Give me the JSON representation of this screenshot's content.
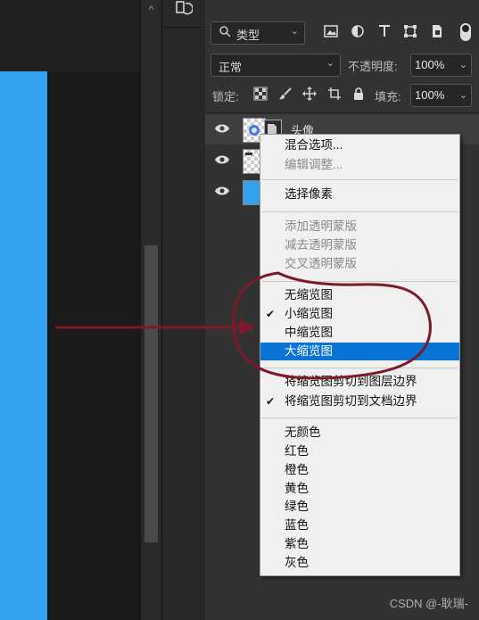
{
  "filter": {
    "label": "类型"
  },
  "blend": {
    "mode": "正常",
    "opacity_label": "不透明度:",
    "opacity_value": "100%"
  },
  "lock": {
    "label": "锁定:",
    "fill_label": "填充:",
    "fill_value": "100%"
  },
  "layers": [
    {
      "name": "头像"
    },
    {
      "name": ""
    },
    {
      "name": ""
    }
  ],
  "menu": {
    "items": [
      {
        "label": "混合选项...",
        "checked": false,
        "disabled": false,
        "active": false
      },
      {
        "label": "编辑调整...",
        "checked": false,
        "disabled": true,
        "active": false
      },
      {
        "label": "选择像素",
        "checked": false,
        "disabled": false,
        "active": false
      },
      {
        "label": "添加透明蒙版",
        "checked": false,
        "disabled": true,
        "active": false
      },
      {
        "label": "减去透明蒙版",
        "checked": false,
        "disabled": true,
        "active": false
      },
      {
        "label": "交叉透明蒙版",
        "checked": false,
        "disabled": true,
        "active": false
      },
      {
        "label": "无缩览图",
        "checked": false,
        "disabled": false,
        "active": false
      },
      {
        "label": "小缩览图",
        "checked": true,
        "disabled": false,
        "active": false
      },
      {
        "label": "中缩览图",
        "checked": false,
        "disabled": false,
        "active": false
      },
      {
        "label": "大缩览图",
        "checked": false,
        "disabled": false,
        "active": true
      },
      {
        "label": "将缩览图剪切到图层边界",
        "checked": false,
        "disabled": false,
        "active": false
      },
      {
        "label": "将缩览图剪切到文档边界",
        "checked": true,
        "disabled": false,
        "active": false
      },
      {
        "label": "无颜色",
        "checked": false,
        "disabled": false,
        "active": false
      },
      {
        "label": "红色",
        "checked": false,
        "disabled": false,
        "active": false
      },
      {
        "label": "橙色",
        "checked": false,
        "disabled": false,
        "active": false
      },
      {
        "label": "黄色",
        "checked": false,
        "disabled": false,
        "active": false
      },
      {
        "label": "绿色",
        "checked": false,
        "disabled": false,
        "active": false
      },
      {
        "label": "蓝色",
        "checked": false,
        "disabled": false,
        "active": false
      },
      {
        "label": "紫色",
        "checked": false,
        "disabled": false,
        "active": false
      },
      {
        "label": "灰色",
        "checked": false,
        "disabled": false,
        "active": false
      }
    ],
    "check_glyph": "✔"
  },
  "colors": {
    "canvas_blue": "#34a3ef",
    "highlight": "#0a74d6",
    "annotation": "#7a1a2a"
  },
  "watermark": "CSDN @-耿瑞-"
}
